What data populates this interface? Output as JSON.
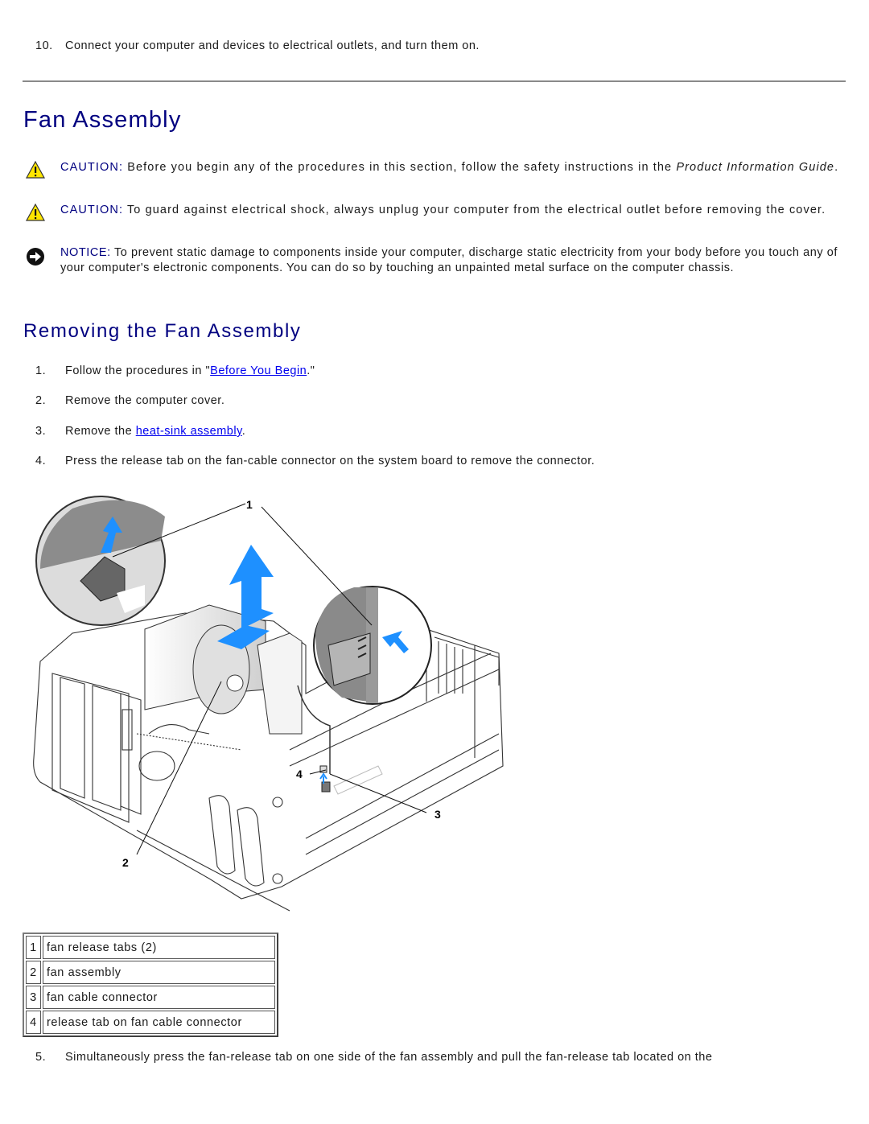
{
  "previous_step": {
    "number": "10.",
    "text": "Connect your computer and devices to electrical outlets, and turn them on."
  },
  "section_title": "Fan Assembly",
  "notices": [
    {
      "type": "caution",
      "icon": "warning-triangle-icon",
      "label": "CAUTION:",
      "text": " Before you begin any of the procedures in this section, follow the safety instructions in the ",
      "italic": "Product Information Guide",
      "suffix": "."
    },
    {
      "type": "caution",
      "icon": "warning-triangle-icon",
      "label": "CAUTION:",
      "text": " To guard against electrical shock, always unplug your computer from the electrical outlet before removing the cover."
    },
    {
      "type": "notice",
      "icon": "notice-arrow-icon",
      "label": "NOTICE:",
      "text": " To prevent static damage to components inside your computer, discharge static electricity from your body before you touch any of your computer's electronic components. You can do so by touching an unpainted metal surface on the computer chassis."
    }
  ],
  "subsection_title": "Removing the Fan Assembly",
  "steps": [
    {
      "number": "1.",
      "before": "Follow the procedures in \"",
      "link": "Before You Begin",
      "after": ".\""
    },
    {
      "number": "2.",
      "text": "Remove the computer cover."
    },
    {
      "number": "3.",
      "before": "Remove the ",
      "link": "heat-sink assembly",
      "after": "."
    },
    {
      "number": "4.",
      "text": "Press the release tab on the fan-cable connector on the system board to remove the connector."
    }
  ],
  "figure": {
    "callouts": [
      "1",
      "2",
      "3",
      "4"
    ],
    "arrow_color": "#1e90ff"
  },
  "legend": [
    {
      "number": "1",
      "label": "fan release tabs (2)"
    },
    {
      "number": "2",
      "label": "fan assembly"
    },
    {
      "number": "3",
      "label": "fan cable connector"
    },
    {
      "number": "4",
      "label": "release tab on fan cable connector"
    }
  ],
  "next_step": {
    "number": "5.",
    "text": "Simultaneously press the fan-release tab on one side of the fan assembly and pull the fan-release tab located on the"
  },
  "colors": {
    "heading": "#000080",
    "link": "#0000ee",
    "caution_yellow": "#ffe600"
  }
}
